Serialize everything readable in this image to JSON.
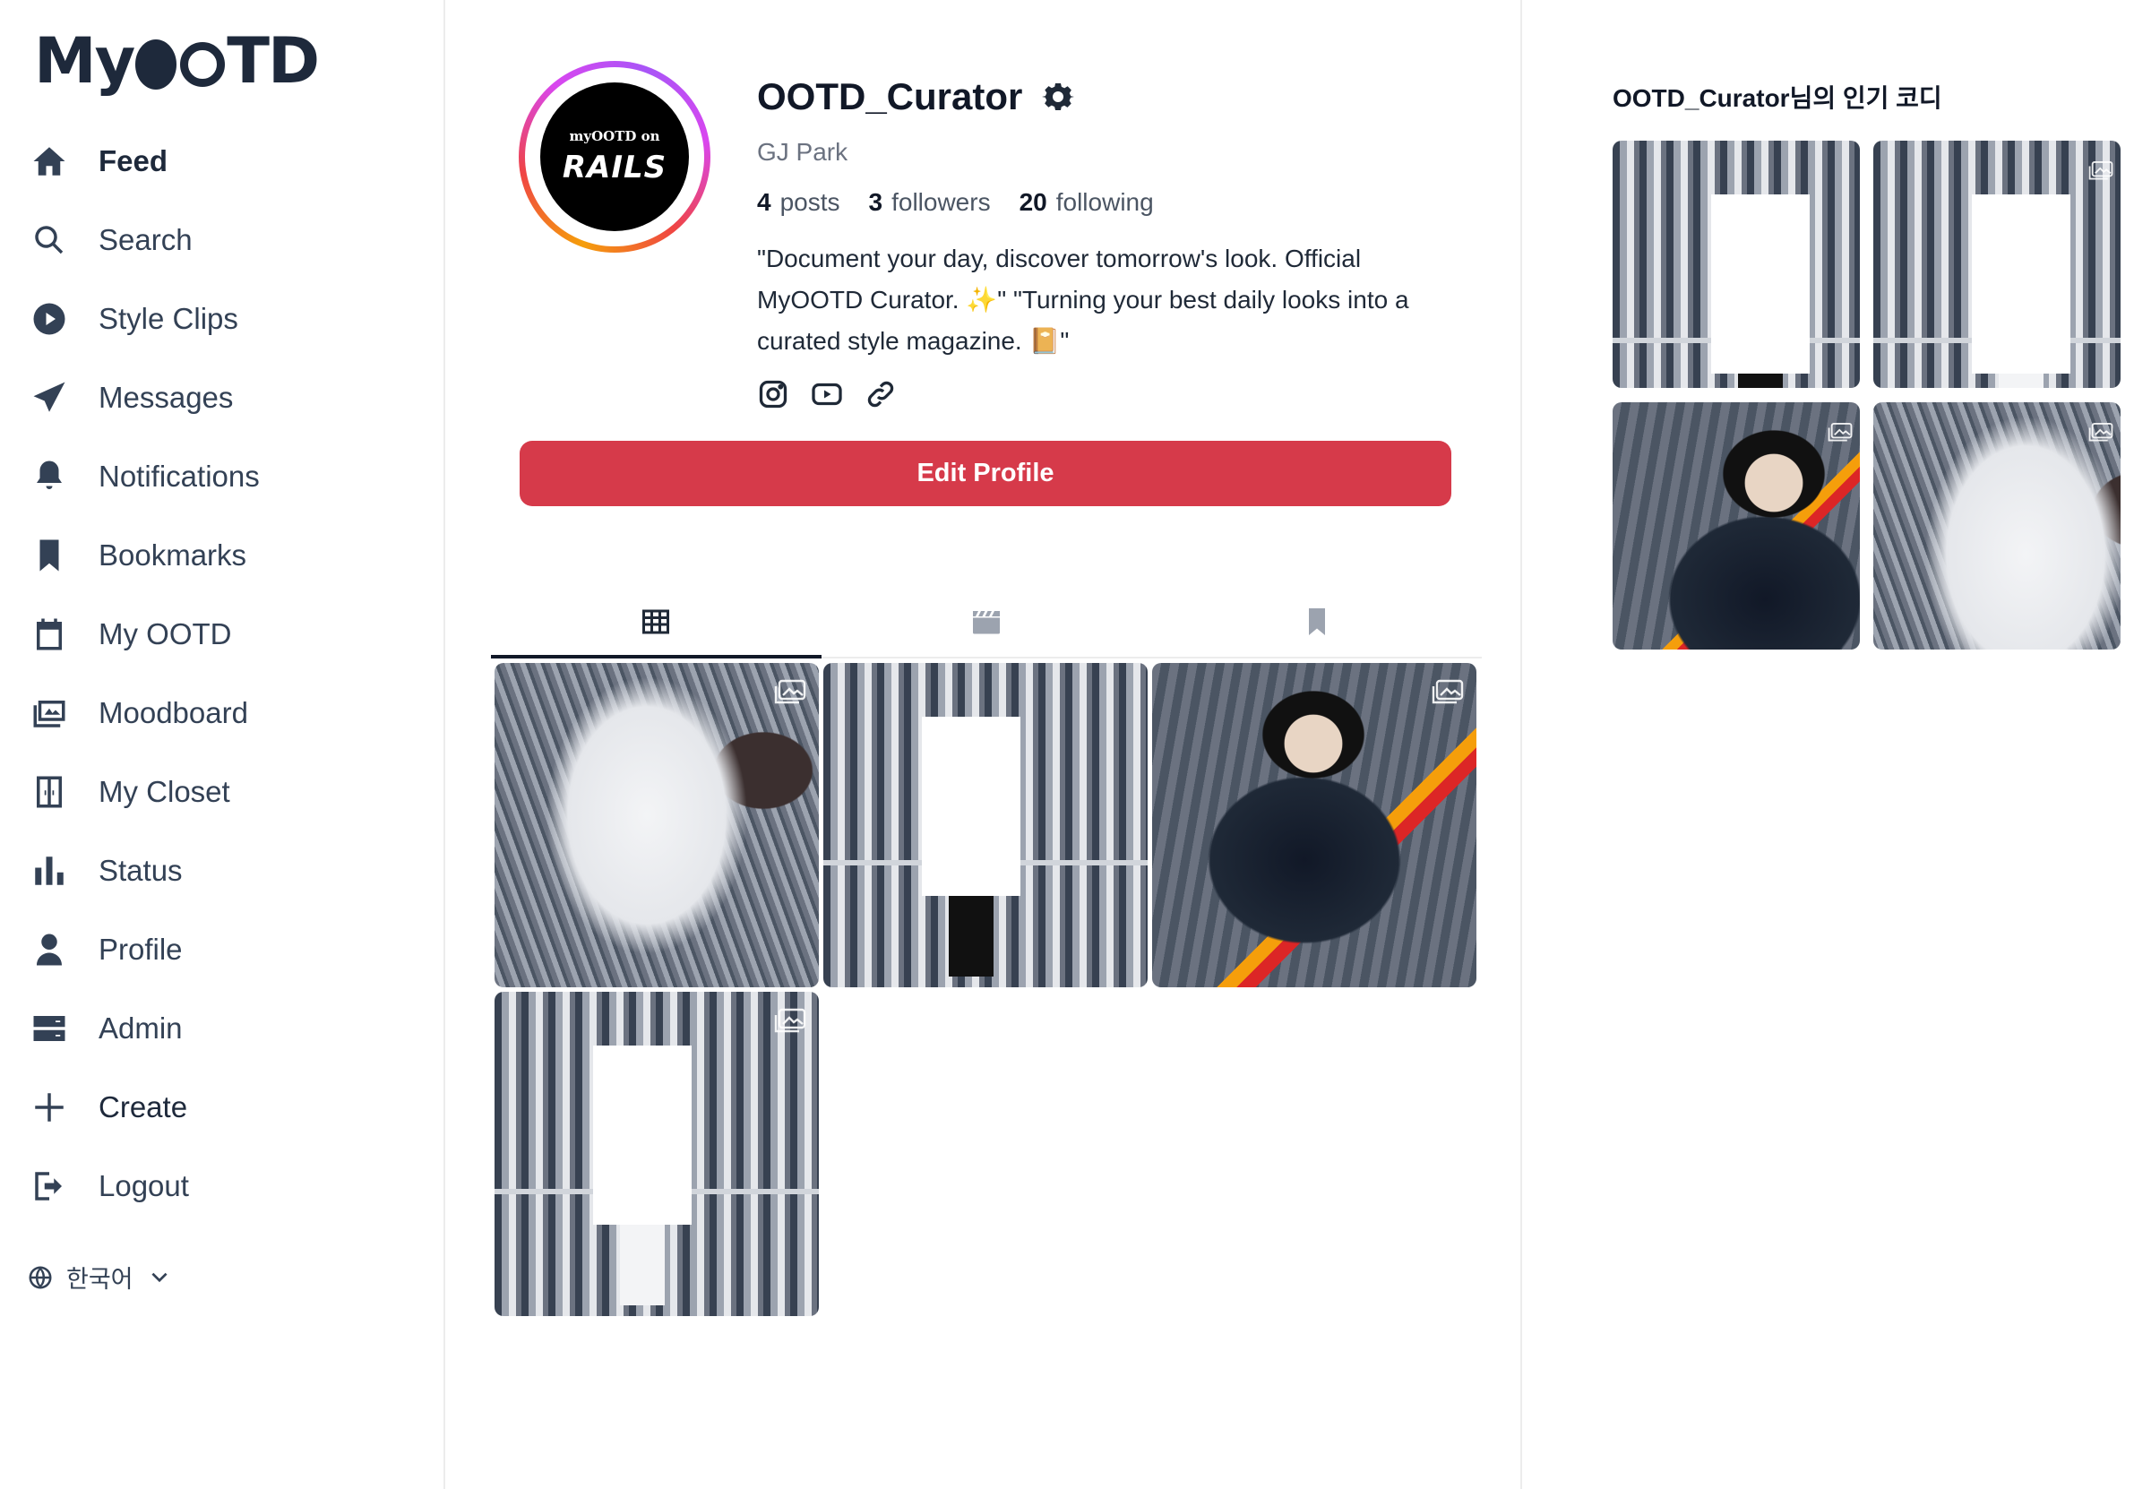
{
  "app": {
    "logo_text": "MyOOTD"
  },
  "sidebar": {
    "items": [
      {
        "label": "Feed",
        "icon": "home-icon"
      },
      {
        "label": "Search",
        "icon": "search-icon"
      },
      {
        "label": "Style Clips",
        "icon": "play-circle-icon"
      },
      {
        "label": "Messages",
        "icon": "paper-plane-icon"
      },
      {
        "label": "Notifications",
        "icon": "bell-icon"
      },
      {
        "label": "Bookmarks",
        "icon": "bookmark-icon"
      },
      {
        "label": "My OOTD",
        "icon": "calendar-icon"
      },
      {
        "label": "Moodboard",
        "icon": "images-icon"
      },
      {
        "label": "My Closet",
        "icon": "closet-icon"
      },
      {
        "label": "Status",
        "icon": "bar-chart-icon"
      },
      {
        "label": "Profile",
        "icon": "user-icon"
      },
      {
        "label": "Admin",
        "icon": "server-icon"
      },
      {
        "label": "Create",
        "icon": "plus-icon"
      },
      {
        "label": "Logout",
        "icon": "logout-icon"
      }
    ],
    "language": "한국어"
  },
  "profile": {
    "avatar_line1": "myOOTD on",
    "avatar_line2": "RAILS",
    "username": "OOTD_Curator",
    "full_name": "GJ Park",
    "stats": {
      "posts_count": "4",
      "posts_label": "posts",
      "followers_count": "3",
      "followers_label": "followers",
      "following_count": "20",
      "following_label": "following"
    },
    "bio": "\"Document your day, discover tomorrow's look. Official MyOOTD Curator. ✨\" \"Turning your best daily looks into a curated style magazine. 📔\"",
    "socials": [
      "instagram-icon",
      "youtube-icon",
      "link-icon"
    ],
    "edit_button": "Edit Profile"
  },
  "tabs": [
    {
      "name": "posts-grid",
      "icon": "grid-icon",
      "active": true
    },
    {
      "name": "clips",
      "icon": "clapperboard-icon",
      "active": false
    },
    {
      "name": "saved",
      "icon": "bookmark-icon",
      "active": false
    }
  ],
  "right_panel": {
    "title": "OOTD_Curator님의 인기 코디"
  },
  "colors": {
    "accent": "#d63a4a",
    "text": "#1f2937",
    "muted": "#6b7280"
  }
}
